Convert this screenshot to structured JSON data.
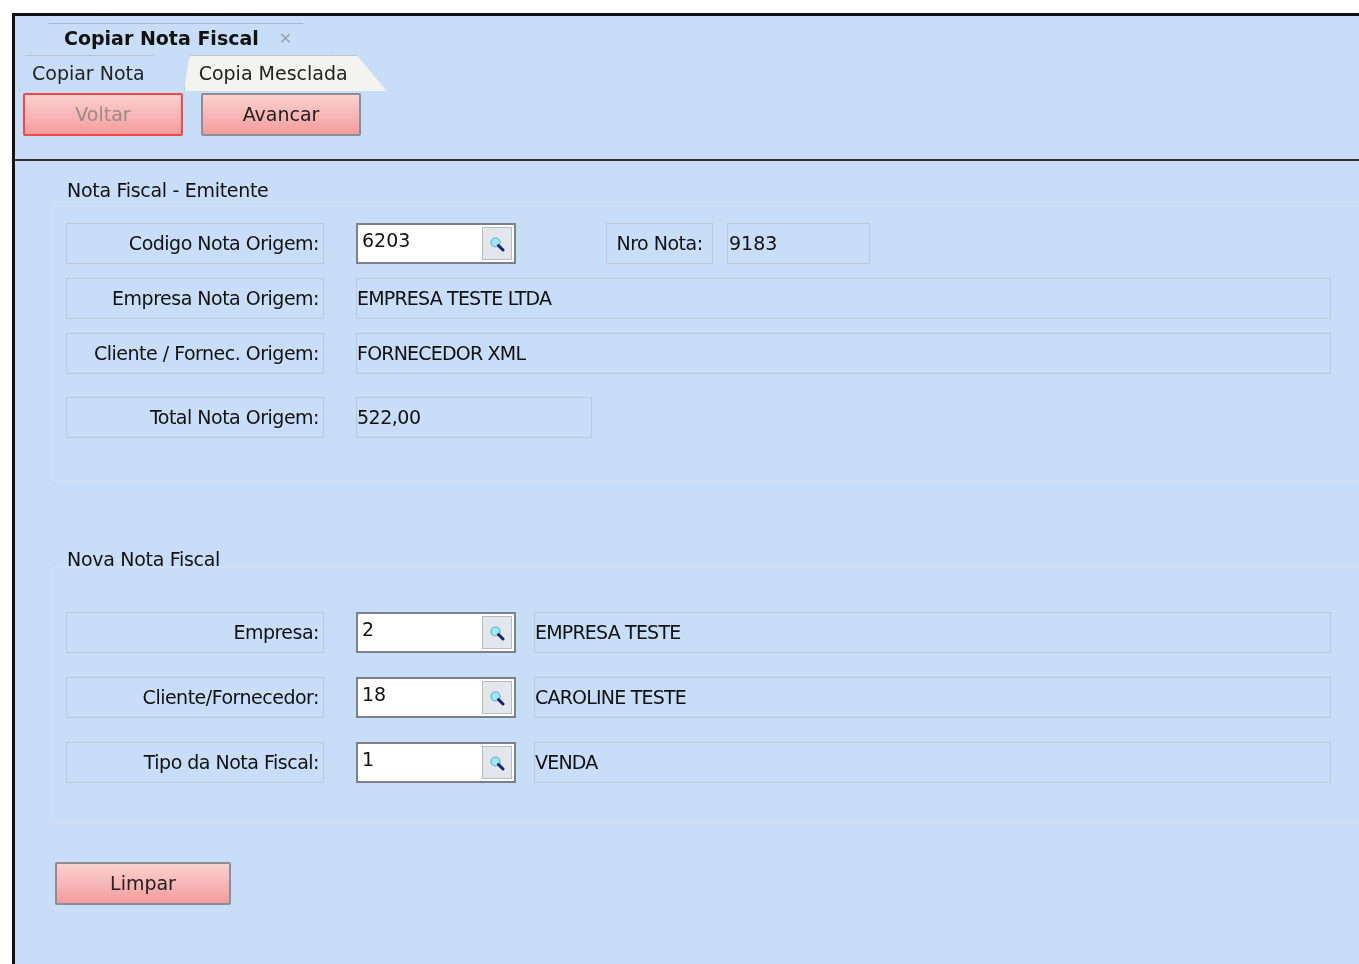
{
  "window_tab": {
    "label": "Copiar Nota Fiscal",
    "close": "✕"
  },
  "subtabs": [
    {
      "label": "Copiar Nota",
      "selected": true
    },
    {
      "label": "Copia Mesclada",
      "selected": false
    }
  ],
  "buttons": [
    {
      "label": "Voltar",
      "disabled": true
    },
    {
      "label": "Avancar",
      "disabled": false
    }
  ],
  "sections": [
    {
      "title": "Nota Fiscal - Emitente",
      "rows": [
        {
          "kind": "lookup",
          "label": "Codigo Nota Origem:",
          "value": "6203",
          "extra_label": "Nro Nota:",
          "extra_value": "9183"
        },
        {
          "kind": "text",
          "label": "Empresa Nota Origem:",
          "value": "EMPRESA TESTE LTDA"
        },
        {
          "kind": "text",
          "label": "Cliente / Fornec. Origem:",
          "value": "FORNECEDOR XML"
        },
        {
          "kind": "short",
          "label": "Total Nota Origem:",
          "value": "522,00"
        }
      ]
    },
    {
      "title": "Nova Nota Fiscal",
      "rows": [
        {
          "kind": "lookup",
          "label": "Empresa:",
          "value": "2",
          "description": "EMPRESA TESTE"
        },
        {
          "kind": "lookup",
          "label": "Cliente/Fornecedor:",
          "value": "18",
          "description": "CAROLINE TESTE"
        },
        {
          "kind": "lookup",
          "label": "Tipo da Nota Fiscal:",
          "value": "1",
          "description": "VENDA"
        }
      ]
    }
  ],
  "clear_button": "Limpar"
}
